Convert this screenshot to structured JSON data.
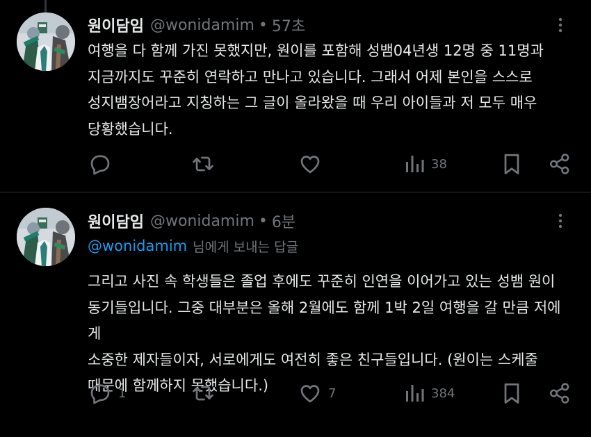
{
  "tweets": [
    {
      "author": {
        "name": "원이담임",
        "handle": "@wonidamim",
        "time": "57초"
      },
      "text": "여행을 다 함께 가진 못했지만, 원이를 포함해 성뱀04년생 12명 중 11명과\n지금까지도 꾸준히 연락하고 만나고 있습니다. 그래서 어제 본인을 스스로\n성지뱀장어라고 지칭하는 그 글이 올라왔을 때 우리 아이들과 저 모두 매우\n당황했습니다.",
      "stats": {
        "replies": "",
        "retweets": "",
        "likes": "",
        "views": "38"
      }
    },
    {
      "author": {
        "name": "원이담임",
        "handle": "@wonidamim",
        "time": "6분"
      },
      "replying_to": {
        "handle": "@wonidamim",
        "suffix": "님에게 보내는 답글"
      },
      "text": "그리고 사진 속 학생들은 졸업 후에도 꾸준히 인연을 이어가고 있는 성뱀 원이\n동기들입니다. 그중 대부분은 올해 2월에도 함께 1박 2일 여행을 갈 만큼 저에게\n소중한 제자들이자, 서로에게도 여전히 좋은 친구들입니다. (원이는 스케줄\n때문에 함께하지 못했습니다.)",
      "stats": {
        "replies": "1",
        "retweets": "",
        "likes": "7",
        "views": "384"
      }
    }
  ],
  "icons": {
    "more": "more-vertical-icon",
    "reply": "reply-icon",
    "retweet": "retweet-icon",
    "like": "heart-icon",
    "views": "views-icon",
    "bookmark": "bookmark-icon",
    "share": "share-icon"
  },
  "colors": {
    "background": "#000000",
    "text": "#e7e9ea",
    "muted": "#71767b",
    "link": "#1d9bf0",
    "divider": "#2f3336"
  }
}
